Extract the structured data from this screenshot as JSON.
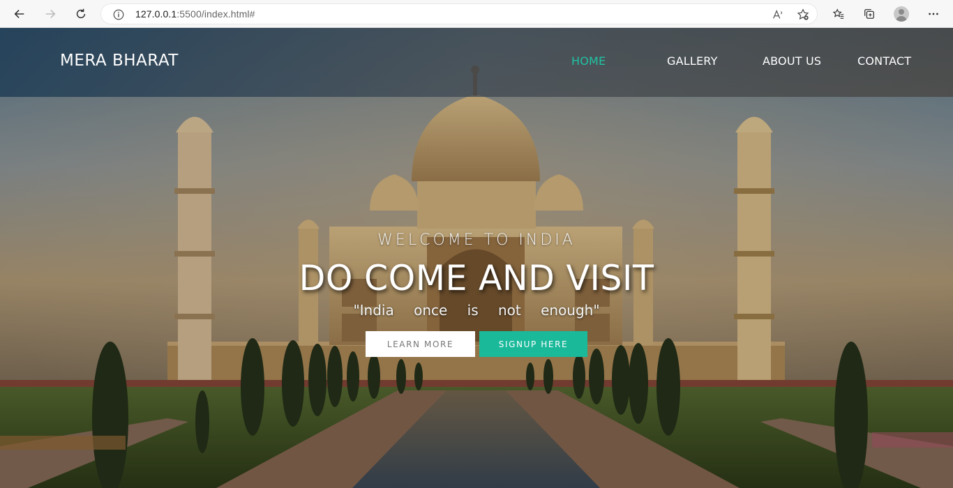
{
  "browser": {
    "url_host": "127.0.0.1",
    "url_rest": ":5500/index.html#",
    "icons": [
      "back-arrow-icon",
      "forward-arrow-icon",
      "refresh-icon",
      "info-icon",
      "read-aloud-icon",
      "add-favorite-icon",
      "favorites-icon",
      "collections-icon",
      "profile-avatar-icon",
      "more-menu-icon"
    ]
  },
  "site": {
    "brand": "MERA BHARAT",
    "nav": [
      {
        "label": "HOME",
        "active": true
      },
      {
        "label": "GALLERY",
        "active": false
      },
      {
        "label": "ABOUT US",
        "active": false
      },
      {
        "label": "CONTACT",
        "active": false
      }
    ],
    "accent_color": "#1ab99a"
  },
  "hero": {
    "welcome": "WELCOME TO INDIA",
    "headline": "DO COME AND VISIT",
    "quote": "\"India once is not enough\"",
    "learn_more": "LEARN MORE",
    "signup": "SIGNUP HERE"
  }
}
